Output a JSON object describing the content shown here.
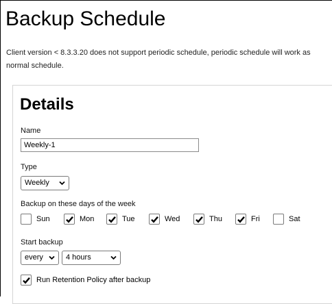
{
  "page": {
    "title": "Backup Schedule",
    "notice": "Client version < 8.3.3.20 does not support periodic schedule, periodic schedule will work as normal schedule."
  },
  "details": {
    "heading": "Details",
    "name_label": "Name",
    "name_value": "Weekly-1",
    "type_label": "Type",
    "type_value": "Weekly",
    "days_label": "Backup on these days of the week",
    "days": [
      {
        "label": "Sun",
        "checked": false
      },
      {
        "label": "Mon",
        "checked": true
      },
      {
        "label": "Tue",
        "checked": true
      },
      {
        "label": "Wed",
        "checked": true
      },
      {
        "label": "Thu",
        "checked": true
      },
      {
        "label": "Fri",
        "checked": true
      },
      {
        "label": "Sat",
        "checked": false
      }
    ],
    "start_label": "Start backup",
    "start_mode": "every",
    "start_interval": "4 hours",
    "retention_label": "Run Retention Policy after backup",
    "retention_checked": true
  },
  "icons": {
    "check": "checkmark-icon",
    "dropdown": "chevron-down-icon"
  }
}
